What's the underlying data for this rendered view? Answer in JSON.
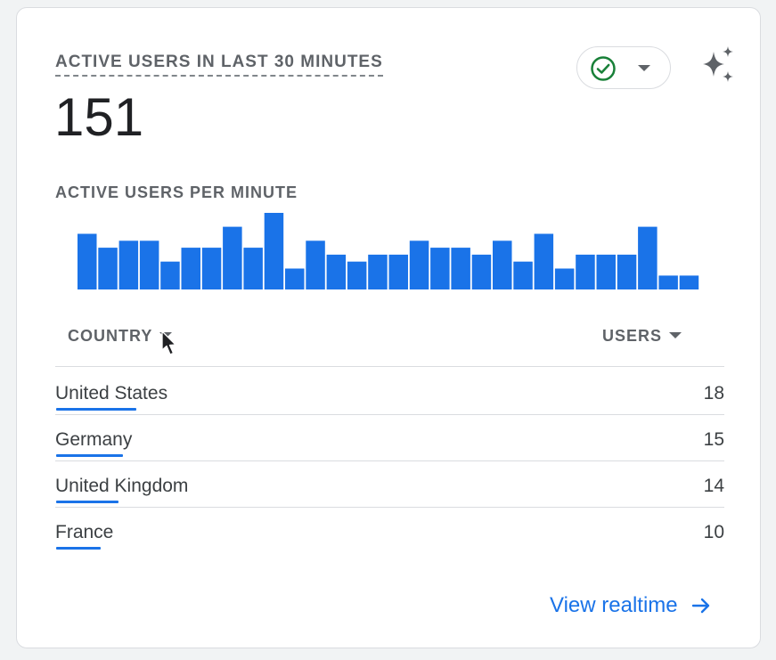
{
  "card": {
    "metric_label": "ACTIVE USERS IN LAST 30 MINUTES",
    "metric_value": "151",
    "status": "ok"
  },
  "chart": {
    "label": "ACTIVE USERS PER MINUTE"
  },
  "chart_data": {
    "type": "bar",
    "values": [
      8,
      6,
      7,
      7,
      4,
      6,
      6,
      9,
      6,
      11,
      3,
      7,
      5,
      4,
      5,
      5,
      7,
      6,
      6,
      5,
      7,
      4,
      8,
      3,
      5,
      5,
      5,
      9,
      2,
      2
    ],
    "title": "ACTIVE USERS PER MINUTE",
    "xlabel": "",
    "ylabel": "",
    "grid": false,
    "color": "#1a73e8"
  },
  "table": {
    "col_country": "COUNTRY",
    "col_users": "USERS",
    "max": 18,
    "rows": [
      {
        "name": "United States",
        "users": "18",
        "n": 18
      },
      {
        "name": "Germany",
        "users": "15",
        "n": 15
      },
      {
        "name": "United Kingdom",
        "users": "14",
        "n": 14
      },
      {
        "name": "France",
        "users": "10",
        "n": 10
      }
    ]
  },
  "link": {
    "label": "View realtime"
  },
  "colors": {
    "accent": "#1a73e8",
    "ok": "#188038",
    "muted": "#5f6368"
  },
  "icons": {
    "status": "check-circle-icon",
    "caret": "caret-down-icon",
    "insights": "sparkle-icon",
    "arrow": "arrow-right-icon"
  }
}
